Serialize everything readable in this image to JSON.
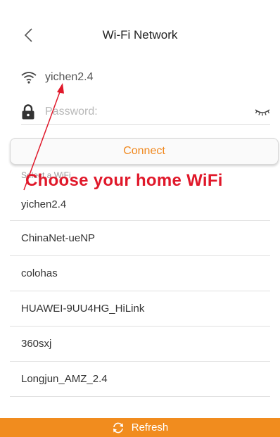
{
  "header": {
    "title": "Wi-Fi Network"
  },
  "ssid": {
    "value": "yichen2.4"
  },
  "password": {
    "placeholder": "Password:",
    "value": ""
  },
  "connect_label": "Connect",
  "list": {
    "section_label": "Select a WiFi",
    "items": [
      "yichen2.4",
      "ChinaNet-ueNP",
      "colohas",
      "HUAWEI-9UU4HG_HiLink",
      "360sxj",
      "Longjun_AMZ_2.4"
    ]
  },
  "annotation": {
    "text": "Choose your home WiFi",
    "color": "#e0182a"
  },
  "refresh_label": "Refresh",
  "colors": {
    "accent": "#f18c1e",
    "connect_text": "#f0881e"
  },
  "icons": {
    "back": "chevron-left-icon",
    "wifi": "wifi-icon",
    "lock": "lock-icon",
    "eye": "eye-closed-icon",
    "refresh": "refresh-icon"
  }
}
